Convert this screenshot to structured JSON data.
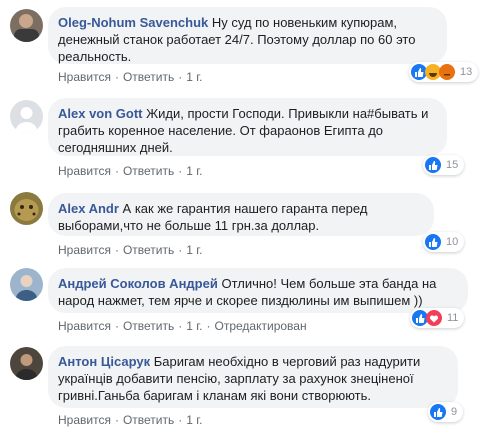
{
  "actions": {
    "like": "Нравится",
    "reply": "Ответить",
    "dot": "·",
    "edited": "Отредактирован"
  },
  "comments": [
    {
      "author": "Oleg-Nohum Savenchuk",
      "text": "Ну суд по новеньким купюрам, денежный станок работает 24/7. Поэтому доллар по 60 это реальность.",
      "time": "1 г.",
      "reactions": [
        "like-icon",
        "haha-icon",
        "angry-icon"
      ],
      "count": "13"
    },
    {
      "author": "Alex von Gott",
      "text": "Жиди, прости Господи. Привыкли на#бывать и грабить коренное население. От фараонов Египта до сегодняшних дней.",
      "time": "1 г.",
      "reactions": [
        "like-icon"
      ],
      "count": "15"
    },
    {
      "author": "Alex Andr",
      "text": "А как же гарантия нашего гаранта перед выборами,что не больше 11 грн.за доллар.",
      "time": "1 г.",
      "reactions": [
        "like-icon"
      ],
      "count": "10"
    },
    {
      "author": "Андрей Соколов Андрей",
      "text": "Отлично! Чем больше эта банда на народ нажмет, тем ярче и скорее пиздюлины им выпишем ))",
      "time": "1 г.",
      "edited": true,
      "reactions": [
        "like-icon",
        "love-icon"
      ],
      "count": "11"
    },
    {
      "author": "Антон Цісарук",
      "text": "Баригам необхідно в черговий раз надурити українців добавити пенсію, зарплату за рахунок знеціненої гривні.Ганьба баригам і кланам які вони створюють.",
      "time": "1 г.",
      "reactions": [
        "like-icon"
      ],
      "count": "9"
    }
  ],
  "colors": {
    "link": "#385898",
    "bubble": "#f2f3f5",
    "like": "#1877f2",
    "love": "#f33e58",
    "haha": "#f7b125"
  }
}
